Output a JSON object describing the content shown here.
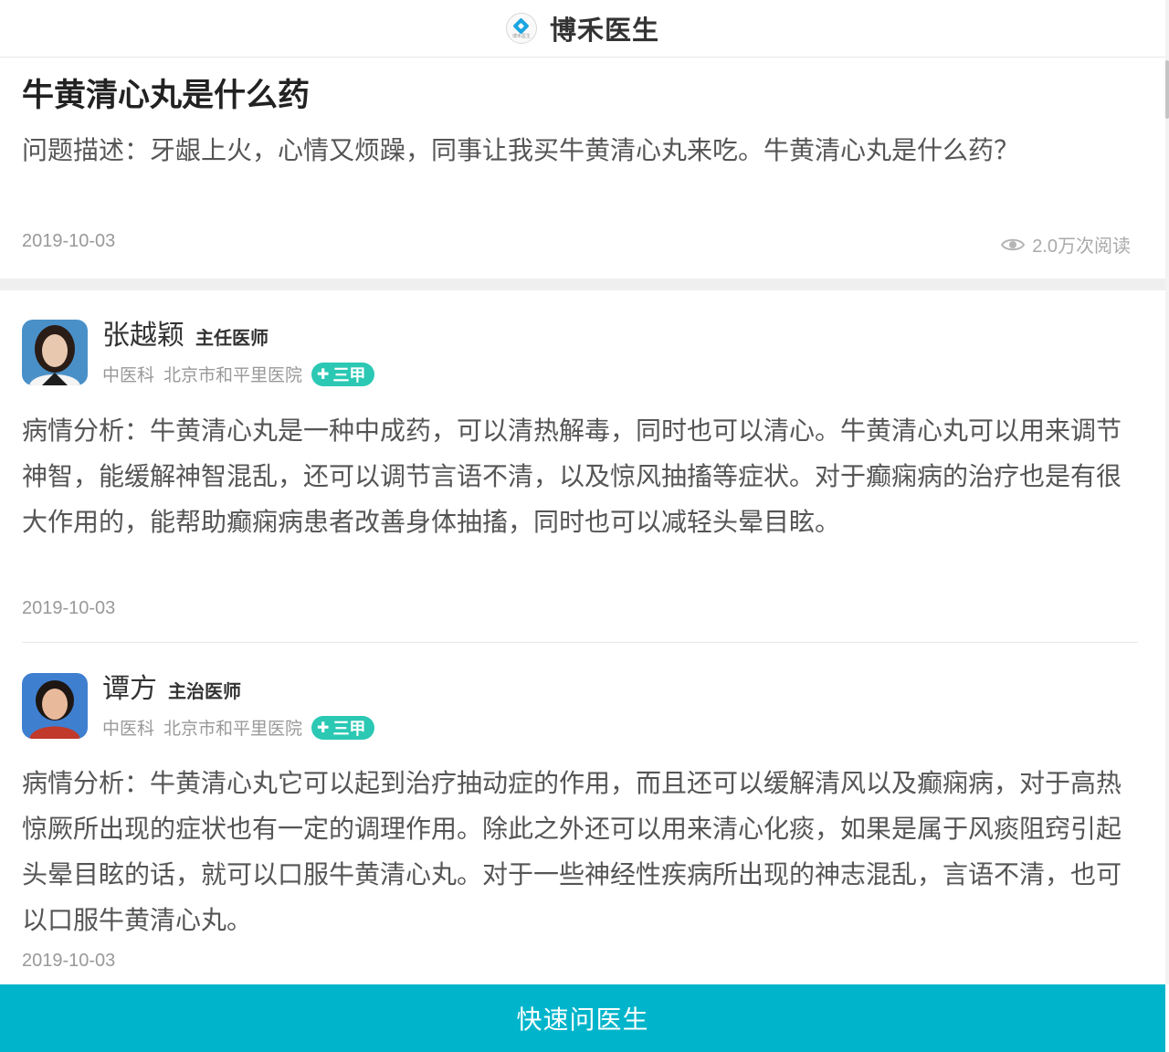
{
  "header": {
    "brand": "博禾医生",
    "logo_caption": "博禾医生"
  },
  "question": {
    "title": "牛黄清心丸是什么药",
    "description": "问题描述：牙龈上火，心情又烦躁，同事让我买牛黄清心丸来吃。牛黄清心丸是什么药？",
    "date": "2019-10-03",
    "views": "2.0万次阅读"
  },
  "answers": [
    {
      "name": "张越颖",
      "title": "主任医师",
      "department": "中医科",
      "hospital": "北京市和平里医院",
      "badge": "三甲",
      "analysis": "病情分析：牛黄清心丸是一种中成药，可以清热解毒，同时也可以清心。牛黄清心丸可以用来调节神智，能缓解神智混乱，还可以调节言语不清，以及惊风抽搐等症状。对于癫痫病的治疗也是有很大作用的，能帮助癫痫病患者改善身体抽搐，同时也可以减轻头晕目眩。",
      "date": "2019-10-03"
    },
    {
      "name": "谭方",
      "title": "主治医师",
      "department": "中医科",
      "hospital": "北京市和平里医院",
      "badge": "三甲",
      "analysis": "病情分析：牛黄清心丸它可以起到治疗抽动症的作用，而且还可以缓解清风以及癫痫病，对于高热惊厥所出现的症状也有一定的调理作用。除此之外还可以用来清心化痰，如果是属于风痰阻窍引起头晕目眩的话，就可以口服牛黄清心丸。对于一些神经性疾病所出现的神志混乱，言语不清，也可以口服牛黄清心丸。",
      "date": "2019-10-03"
    }
  ],
  "cta": {
    "label": "快速问医生"
  },
  "colors": {
    "accent": "#00b5cb",
    "badge": "#2bc8b4",
    "brand_icon": "#1ba5e0"
  }
}
